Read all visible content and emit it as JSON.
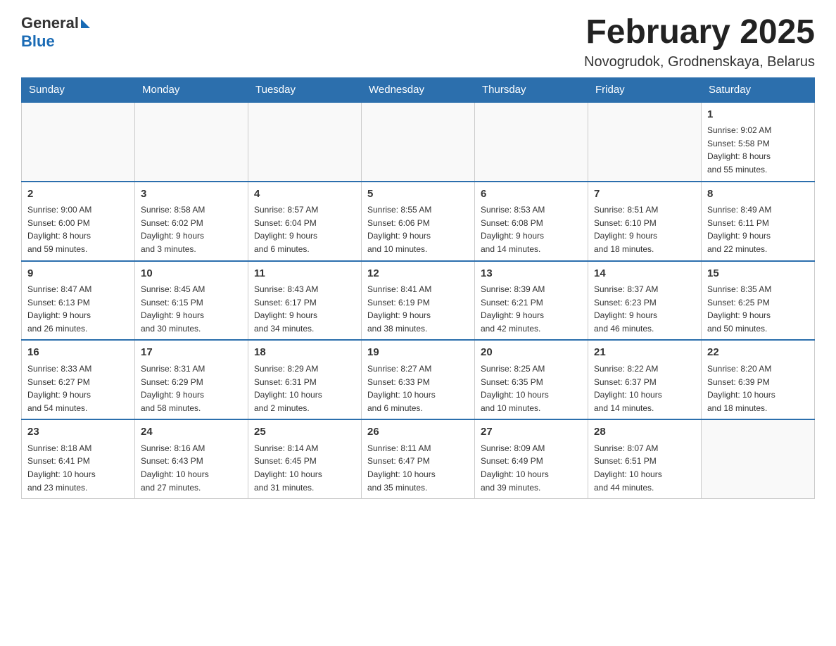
{
  "header": {
    "logo": {
      "general": "General",
      "blue": "Blue"
    },
    "title": "February 2025",
    "subtitle": "Novogrudok, Grodnenskaya, Belarus"
  },
  "weekdays": [
    "Sunday",
    "Monday",
    "Tuesday",
    "Wednesday",
    "Thursday",
    "Friday",
    "Saturday"
  ],
  "weeks": [
    [
      {
        "day": "",
        "info": ""
      },
      {
        "day": "",
        "info": ""
      },
      {
        "day": "",
        "info": ""
      },
      {
        "day": "",
        "info": ""
      },
      {
        "day": "",
        "info": ""
      },
      {
        "day": "",
        "info": ""
      },
      {
        "day": "1",
        "info": "Sunrise: 9:02 AM\nSunset: 5:58 PM\nDaylight: 8 hours\nand 55 minutes."
      }
    ],
    [
      {
        "day": "2",
        "info": "Sunrise: 9:00 AM\nSunset: 6:00 PM\nDaylight: 8 hours\nand 59 minutes."
      },
      {
        "day": "3",
        "info": "Sunrise: 8:58 AM\nSunset: 6:02 PM\nDaylight: 9 hours\nand 3 minutes."
      },
      {
        "day": "4",
        "info": "Sunrise: 8:57 AM\nSunset: 6:04 PM\nDaylight: 9 hours\nand 6 minutes."
      },
      {
        "day": "5",
        "info": "Sunrise: 8:55 AM\nSunset: 6:06 PM\nDaylight: 9 hours\nand 10 minutes."
      },
      {
        "day": "6",
        "info": "Sunrise: 8:53 AM\nSunset: 6:08 PM\nDaylight: 9 hours\nand 14 minutes."
      },
      {
        "day": "7",
        "info": "Sunrise: 8:51 AM\nSunset: 6:10 PM\nDaylight: 9 hours\nand 18 minutes."
      },
      {
        "day": "8",
        "info": "Sunrise: 8:49 AM\nSunset: 6:11 PM\nDaylight: 9 hours\nand 22 minutes."
      }
    ],
    [
      {
        "day": "9",
        "info": "Sunrise: 8:47 AM\nSunset: 6:13 PM\nDaylight: 9 hours\nand 26 minutes."
      },
      {
        "day": "10",
        "info": "Sunrise: 8:45 AM\nSunset: 6:15 PM\nDaylight: 9 hours\nand 30 minutes."
      },
      {
        "day": "11",
        "info": "Sunrise: 8:43 AM\nSunset: 6:17 PM\nDaylight: 9 hours\nand 34 minutes."
      },
      {
        "day": "12",
        "info": "Sunrise: 8:41 AM\nSunset: 6:19 PM\nDaylight: 9 hours\nand 38 minutes."
      },
      {
        "day": "13",
        "info": "Sunrise: 8:39 AM\nSunset: 6:21 PM\nDaylight: 9 hours\nand 42 minutes."
      },
      {
        "day": "14",
        "info": "Sunrise: 8:37 AM\nSunset: 6:23 PM\nDaylight: 9 hours\nand 46 minutes."
      },
      {
        "day": "15",
        "info": "Sunrise: 8:35 AM\nSunset: 6:25 PM\nDaylight: 9 hours\nand 50 minutes."
      }
    ],
    [
      {
        "day": "16",
        "info": "Sunrise: 8:33 AM\nSunset: 6:27 PM\nDaylight: 9 hours\nand 54 minutes."
      },
      {
        "day": "17",
        "info": "Sunrise: 8:31 AM\nSunset: 6:29 PM\nDaylight: 9 hours\nand 58 minutes."
      },
      {
        "day": "18",
        "info": "Sunrise: 8:29 AM\nSunset: 6:31 PM\nDaylight: 10 hours\nand 2 minutes."
      },
      {
        "day": "19",
        "info": "Sunrise: 8:27 AM\nSunset: 6:33 PM\nDaylight: 10 hours\nand 6 minutes."
      },
      {
        "day": "20",
        "info": "Sunrise: 8:25 AM\nSunset: 6:35 PM\nDaylight: 10 hours\nand 10 minutes."
      },
      {
        "day": "21",
        "info": "Sunrise: 8:22 AM\nSunset: 6:37 PM\nDaylight: 10 hours\nand 14 minutes."
      },
      {
        "day": "22",
        "info": "Sunrise: 8:20 AM\nSunset: 6:39 PM\nDaylight: 10 hours\nand 18 minutes."
      }
    ],
    [
      {
        "day": "23",
        "info": "Sunrise: 8:18 AM\nSunset: 6:41 PM\nDaylight: 10 hours\nand 23 minutes."
      },
      {
        "day": "24",
        "info": "Sunrise: 8:16 AM\nSunset: 6:43 PM\nDaylight: 10 hours\nand 27 minutes."
      },
      {
        "day": "25",
        "info": "Sunrise: 8:14 AM\nSunset: 6:45 PM\nDaylight: 10 hours\nand 31 minutes."
      },
      {
        "day": "26",
        "info": "Sunrise: 8:11 AM\nSunset: 6:47 PM\nDaylight: 10 hours\nand 35 minutes."
      },
      {
        "day": "27",
        "info": "Sunrise: 8:09 AM\nSunset: 6:49 PM\nDaylight: 10 hours\nand 39 minutes."
      },
      {
        "day": "28",
        "info": "Sunrise: 8:07 AM\nSunset: 6:51 PM\nDaylight: 10 hours\nand 44 minutes."
      },
      {
        "day": "",
        "info": ""
      }
    ]
  ]
}
